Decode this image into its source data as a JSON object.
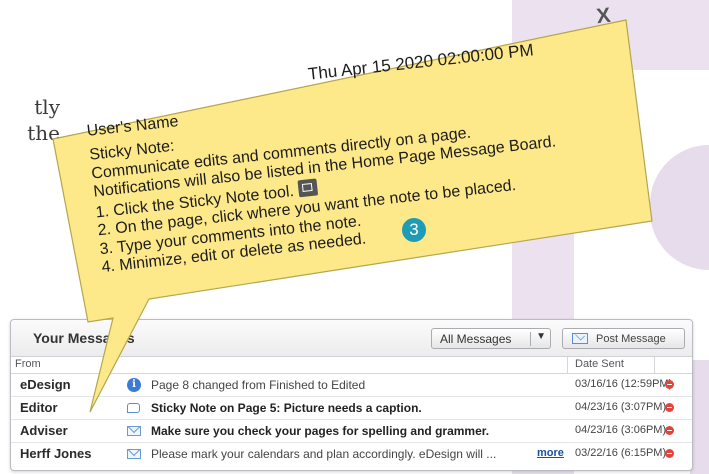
{
  "background_text": [
    "tly",
    "the"
  ],
  "messages_panel": {
    "title": "Your Messages",
    "filter": {
      "selected": "All Messages"
    },
    "post_button": "Post Message",
    "columns": {
      "from": "From",
      "date_sent": "Date Sent"
    },
    "rows": [
      {
        "from": "eDesign",
        "icon": "info-icon",
        "subject": "Page 8 changed from Finished to Edited",
        "bold": false,
        "date": "03/16/16",
        "time": "(12:59PM)"
      },
      {
        "from": "Editor",
        "icon": "speech-bubble-icon",
        "subject": "Sticky Note on Page 5: Picture needs a caption.",
        "bold": true,
        "date": "04/23/16",
        "time": "(3:07PM)"
      },
      {
        "from": "Adviser",
        "icon": "envelope-icon",
        "subject": "Make sure you check your pages for spelling and grammer.",
        "bold": true,
        "date": "04/23/16",
        "time": "(3:06PM)"
      },
      {
        "from": "Herff Jones",
        "icon": "envelope-icon",
        "subject": "Please mark your calendars and plan accordingly. eDesign will ...",
        "bold": false,
        "more": "more",
        "date": "03/22/16",
        "time": "(6:15PM)"
      }
    ]
  },
  "sticky_note": {
    "timestamp": "Thu Apr 15 2020 02:00:00 PM",
    "close": "X",
    "user": "User's Name",
    "lines": [
      "Sticky Note:",
      "Communicate edits and comments directly on a page.",
      "Notifications will also be listed in the Home Page Message Board.",
      "1. Click the Sticky Note tool.",
      "2. On the page, click where you want the note to be placed.",
      "3. Type your comments into the note.",
      "4. Minimize, edit or delete as needed."
    ],
    "step_badge": "3",
    "color": "#fde98a"
  },
  "colors": {
    "accent": "#1e9bb5",
    "delete": "#e0453b",
    "link": "#1d4fa0"
  }
}
